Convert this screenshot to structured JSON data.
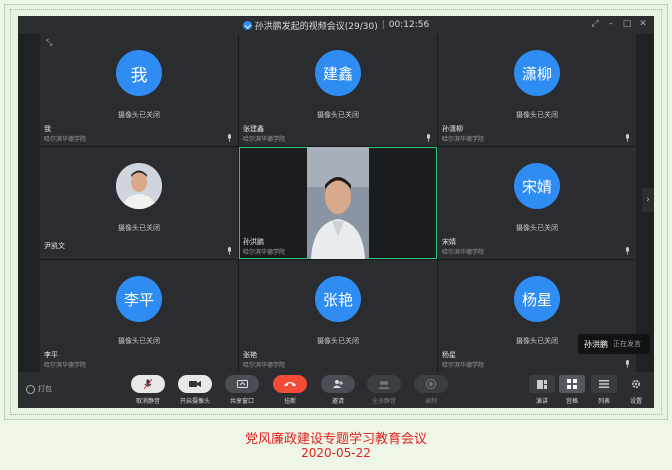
{
  "titlebar": {
    "meeting_title": "孙洪鹏发起的视频会议(29/30)",
    "duration": "00:12:56"
  },
  "camera_off_text": "摄像头已关闭",
  "participants": [
    {
      "avatar_text": "我",
      "name": "我",
      "org": "哈尔滨华德学院"
    },
    {
      "avatar_text": "建鑫",
      "name": "张建鑫",
      "org": "哈尔滨华德学院"
    },
    {
      "avatar_text": "潇柳",
      "name": "孙潇柳",
      "org": "哈尔滨华德学院"
    },
    {
      "avatar_text": "",
      "name": "尹凯文",
      "org": ""
    },
    {
      "avatar_text": "",
      "name": "孙洪鹏",
      "org": "哈尔滨华德学院"
    },
    {
      "avatar_text": "宋婧",
      "name": "宋婧",
      "org": "哈尔滨华德学院"
    },
    {
      "avatar_text": "李平",
      "name": "李平",
      "org": "哈尔滨华德学院"
    },
    {
      "avatar_text": "张艳",
      "name": "张艳",
      "org": "哈尔滨华德学院"
    },
    {
      "avatar_text": "杨星",
      "name": "杨星",
      "org": "哈尔滨华德学院"
    }
  ],
  "speaking": {
    "name": "孙洪鹏",
    "status": "正在发言"
  },
  "toolbar": {
    "lock_label": "打包",
    "mute": "取消静音",
    "camera": "开启摄像头",
    "share": "共享窗口",
    "hangup": "挂断",
    "invite": "邀请",
    "mute_all": "全员静音",
    "record": "录制",
    "speaker_view": "演讲",
    "gallery_view": "宫格",
    "list_view": "列表",
    "settings": "设置"
  },
  "caption": {
    "title": "党风廉政建设专题学习教育会议",
    "date": "2020-05-22"
  },
  "colors": {
    "accent": "#2f8cf2",
    "active_border": "#2fc57a",
    "hangup": "#f24b36",
    "caption": "#e2201c"
  }
}
